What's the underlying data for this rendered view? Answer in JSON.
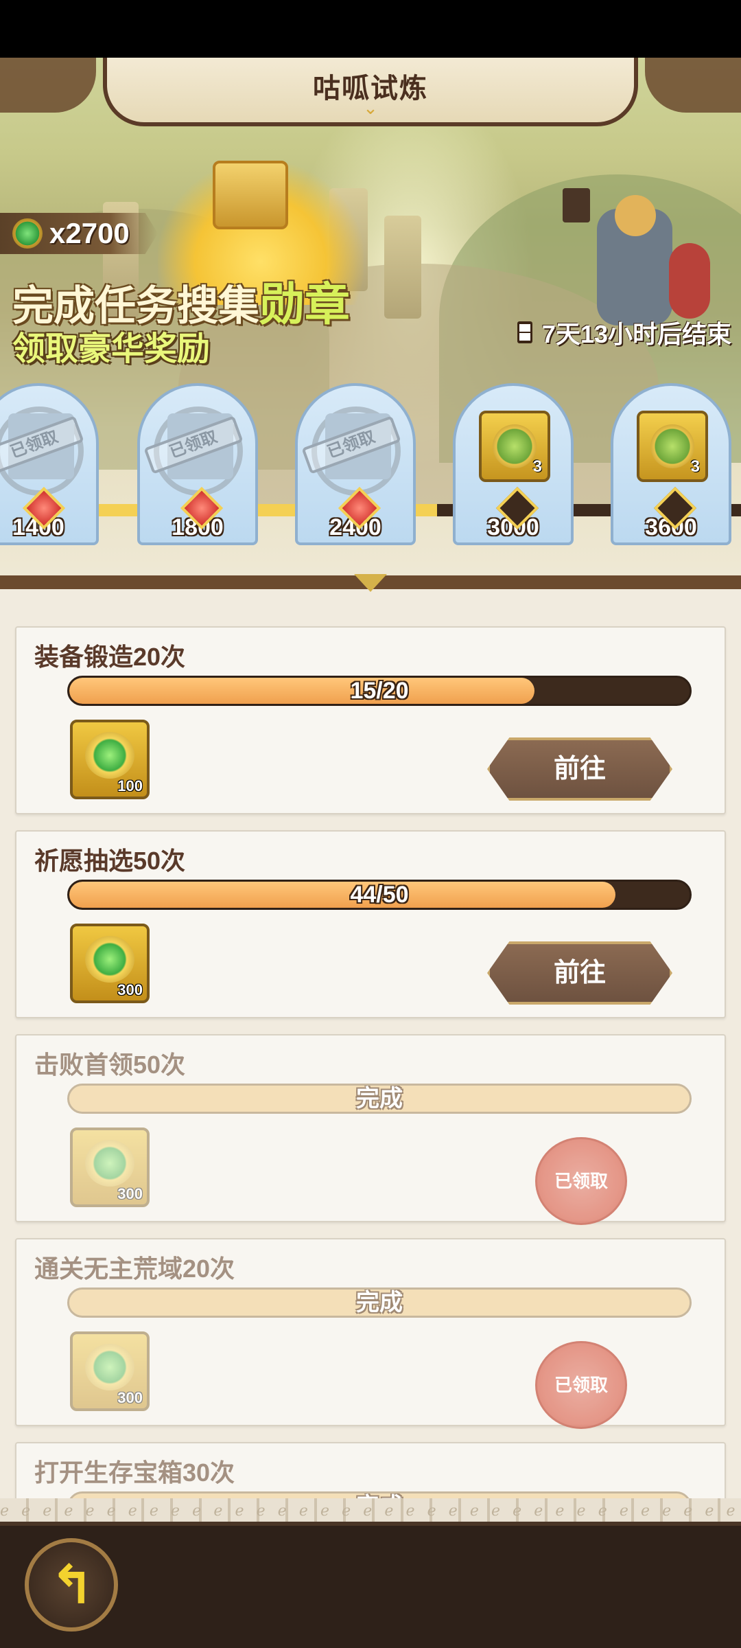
{
  "header": {
    "title": "咕呱试炼"
  },
  "banner": {
    "medal_count": "x2700",
    "headline_line1_main": "完成任务搜集",
    "headline_line1_highlight": "勋章",
    "headline_line2": "领取豪华奖励",
    "timer": "7天13小时后结束",
    "progress": 0.59,
    "milestones": [
      {
        "value": "1400",
        "state": "claimed",
        "stamp": "已领取"
      },
      {
        "value": "1800",
        "state": "claimed",
        "stamp": "已领取"
      },
      {
        "value": "2400",
        "state": "claimed",
        "stamp": "已领取"
      },
      {
        "value": "3000",
        "state": "locked",
        "reward_qty": "3"
      },
      {
        "value": "3600",
        "state": "locked",
        "reward_qty": "3"
      }
    ]
  },
  "tasks": [
    {
      "title": "装备锻造20次",
      "progress_text": "15/20",
      "progress": 0.75,
      "reward_amount": "100",
      "action": "前往",
      "done": false
    },
    {
      "title": "祈愿抽选50次",
      "progress_text": "44/50",
      "progress": 0.88,
      "reward_amount": "300",
      "action": "前往",
      "done": false
    },
    {
      "title": "击败首领50次",
      "progress_text": "完成",
      "progress": 1.0,
      "reward_amount": "300",
      "action": "已领取",
      "done": true
    },
    {
      "title": "通关无主荒域20次",
      "progress_text": "完成",
      "progress": 1.0,
      "reward_amount": "300",
      "action": "已领取",
      "done": true
    },
    {
      "title": "打开生存宝箱30次",
      "progress_text": "完成",
      "progress": 1.0,
      "reward_amount": "",
      "action": "",
      "done": true
    }
  ],
  "colors": {
    "accent_gold": "#f4d054",
    "dark_brown": "#3d2a1d",
    "bar_orange": "#f0a04e",
    "claimed_red": "#e48f7f"
  },
  "icons": {
    "back": "back-arrow-icon",
    "timer": "hourglass-icon",
    "medal": "medal-icon"
  }
}
